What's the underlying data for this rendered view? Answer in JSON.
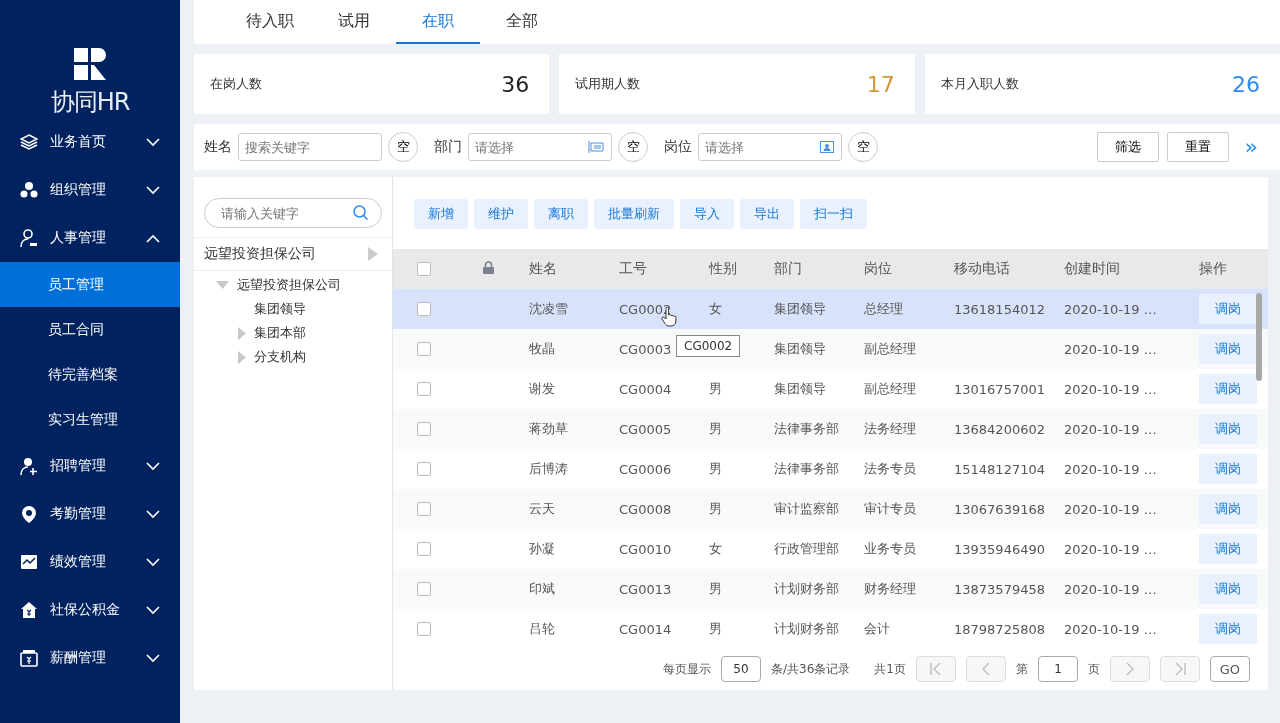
{
  "logo": {
    "text": "协同HR"
  },
  "sidebar": {
    "items": [
      {
        "kind": "group",
        "label": "业务首页",
        "expanded": false
      },
      {
        "kind": "group",
        "label": "组织管理",
        "expanded": false
      },
      {
        "kind": "group",
        "label": "人事管理",
        "expanded": true
      },
      {
        "kind": "sub",
        "label": "员工管理",
        "selected": true
      },
      {
        "kind": "sub",
        "label": "员工合同",
        "selected": false
      },
      {
        "kind": "sub",
        "label": "待完善档案",
        "selected": false
      },
      {
        "kind": "sub",
        "label": "实习生管理",
        "selected": false
      },
      {
        "kind": "group",
        "label": "招聘管理",
        "expanded": false
      },
      {
        "kind": "group",
        "label": "考勤管理",
        "expanded": false
      },
      {
        "kind": "group",
        "label": "绩效管理",
        "expanded": false
      },
      {
        "kind": "group",
        "label": "社保公积金",
        "expanded": false
      },
      {
        "kind": "group",
        "label": "薪酬管理",
        "expanded": false
      }
    ]
  },
  "tabs": [
    {
      "label": "待入职",
      "selected": false
    },
    {
      "label": "试用",
      "selected": false
    },
    {
      "label": "在职",
      "selected": true
    },
    {
      "label": "全部",
      "selected": false
    }
  ],
  "stats": [
    {
      "label": "在岗人数",
      "value": "36",
      "color": "#222222"
    },
    {
      "label": "试用期人数",
      "value": "17",
      "color": "#d4963a"
    },
    {
      "label": "本月入职人数",
      "value": "26",
      "color": "#2d8cf0"
    }
  ],
  "filters": [
    {
      "kind": "text",
      "label": "姓名",
      "placeholder": "搜索关键字",
      "clear": "空"
    },
    {
      "kind": "tree",
      "label": "部门",
      "placeholder": "请选择",
      "clear": "空"
    },
    {
      "kind": "card",
      "label": "岗位",
      "placeholder": "请选择",
      "clear": "空"
    }
  ],
  "filter_buttons": [
    "筛选",
    "重置"
  ],
  "expand": "»",
  "tree": {
    "search_placeholder": "请输入关键字",
    "root": "远望投资担保公司",
    "nodes": [
      {
        "label": "远望投资担保公司",
        "expanded": true,
        "children": [
          {
            "label": "集团领导"
          },
          {
            "label": "集团本部",
            "expanded": false
          },
          {
            "label": "分支机构",
            "expanded": false
          }
        ]
      }
    ]
  },
  "actions": [
    "新增",
    "维护",
    "离职",
    "批量刷新",
    "导入",
    "导出",
    "扫一扫"
  ],
  "table": {
    "all_checked": false,
    "columns": [
      "姓名",
      "工号",
      "性别",
      "部门",
      "岗位",
      "移动电话",
      "创建时间",
      "操作"
    ],
    "rows": [
      {
        "selected": true,
        "checked": false,
        "name": "沈凌雪",
        "id": "CG0002",
        "gender": "女",
        "dept": "集团领导",
        "post": "总经理",
        "phone": "13618154012",
        "created": "2020-10-19 …",
        "action": "调岗"
      },
      {
        "selected": false,
        "checked": false,
        "name": "牧晶",
        "id": "CG0003",
        "dept": "集团领导",
        "post": "副总经理",
        "created": "2020-10-19 …",
        "action": "调岗"
      },
      {
        "selected": false,
        "checked": false,
        "name": "谢发",
        "id": "CG0004",
        "gender": "男",
        "dept": "集团领导",
        "post": "副总经理",
        "phone": "13016757001",
        "created": "2020-10-19 …",
        "action": "调岗"
      },
      {
        "selected": false,
        "checked": false,
        "name": "蒋劲草",
        "id": "CG0005",
        "gender": "男",
        "dept": "法律事务部",
        "post": "法务经理",
        "phone": "13684200602",
        "created": "2020-10-19 …",
        "action": "调岗"
      },
      {
        "selected": false,
        "checked": false,
        "name": "后博涛",
        "id": "CG0006",
        "gender": "男",
        "dept": "法律事务部",
        "post": "法务专员",
        "phone": "15148127104",
        "created": "2020-10-19 …",
        "action": "调岗"
      },
      {
        "selected": false,
        "checked": false,
        "name": "云天",
        "id": "CG0008",
        "gender": "男",
        "dept": "审计监察部",
        "post": "审计专员",
        "phone": "13067639168",
        "created": "2020-10-19 …",
        "action": "调岗"
      },
      {
        "selected": false,
        "checked": false,
        "name": "孙凝",
        "id": "CG0010",
        "gender": "女",
        "dept": "行政管理部",
        "post": "业务专员",
        "phone": "13935946490",
        "created": "2020-10-19 …",
        "action": "调岗"
      },
      {
        "selected": false,
        "checked": false,
        "name": "印斌",
        "id": "CG0013",
        "gender": "男",
        "dept": "计划财务部",
        "post": "财务经理",
        "phone": "13873579458",
        "created": "2020-10-19 …",
        "action": "调岗"
      },
      {
        "selected": false,
        "checked": false,
        "name": "吕轮",
        "id": "CG0014",
        "gender": "男",
        "dept": "计划财务部",
        "post": "会计",
        "phone": "18798725808",
        "created": "2020-10-19 …",
        "action": "调岗"
      }
    ]
  },
  "tooltip": "CG0002",
  "pagination": {
    "per_page_label": "每页显示",
    "per_page": "50",
    "total": "条/共36条记录",
    "pages": "共1页",
    "page_prefix": "第",
    "page": "1",
    "page_suffix": "页",
    "go": "GO"
  }
}
